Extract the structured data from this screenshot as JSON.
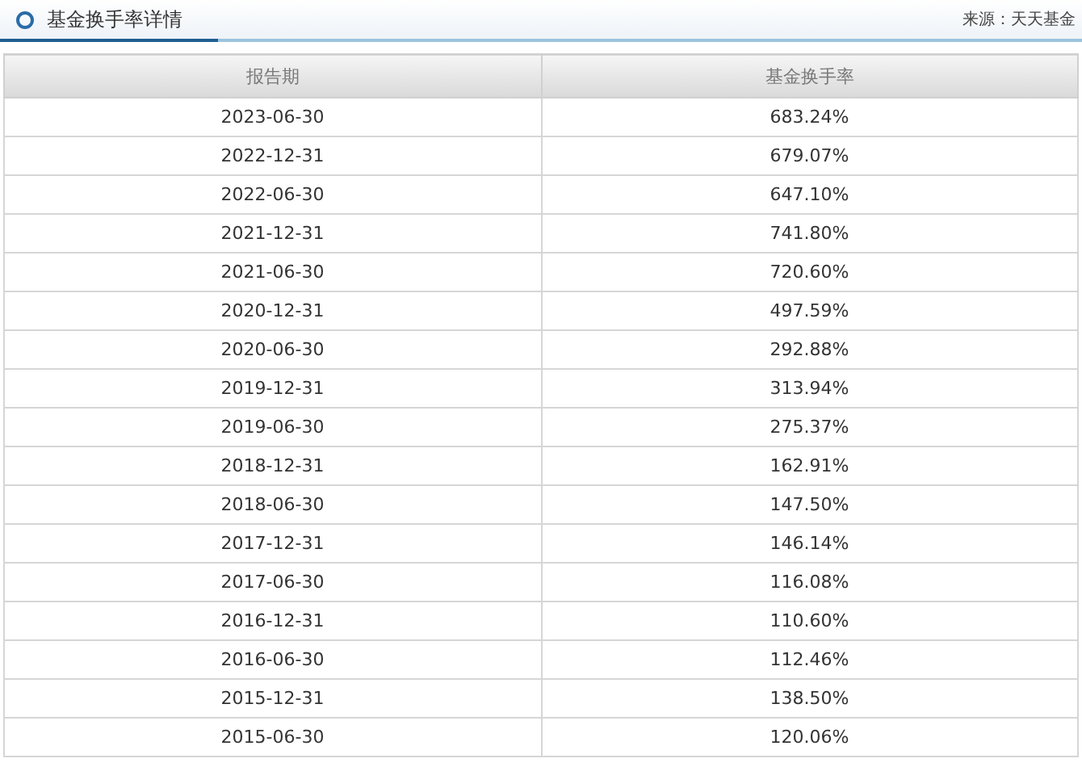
{
  "panel": {
    "title": "基金换手率详情",
    "source": "来源：天天基金"
  },
  "table": {
    "columns": [
      "报告期",
      "基金换手率"
    ],
    "rows": [
      [
        "2023-06-30",
        "683.24%"
      ],
      [
        "2022-12-31",
        "679.07%"
      ],
      [
        "2022-06-30",
        "647.10%"
      ],
      [
        "2021-12-31",
        "741.80%"
      ],
      [
        "2021-06-30",
        "720.60%"
      ],
      [
        "2020-12-31",
        "497.59%"
      ],
      [
        "2020-06-30",
        "292.88%"
      ],
      [
        "2019-12-31",
        "313.94%"
      ],
      [
        "2019-06-30",
        "275.37%"
      ],
      [
        "2018-12-31",
        "162.91%"
      ],
      [
        "2018-06-30",
        "147.50%"
      ],
      [
        "2017-12-31",
        "146.14%"
      ],
      [
        "2017-06-30",
        "116.08%"
      ],
      [
        "2016-12-31",
        "110.60%"
      ],
      [
        "2016-06-30",
        "112.46%"
      ],
      [
        "2015-12-31",
        "138.50%"
      ],
      [
        "2015-06-30",
        "120.06%"
      ]
    ]
  }
}
